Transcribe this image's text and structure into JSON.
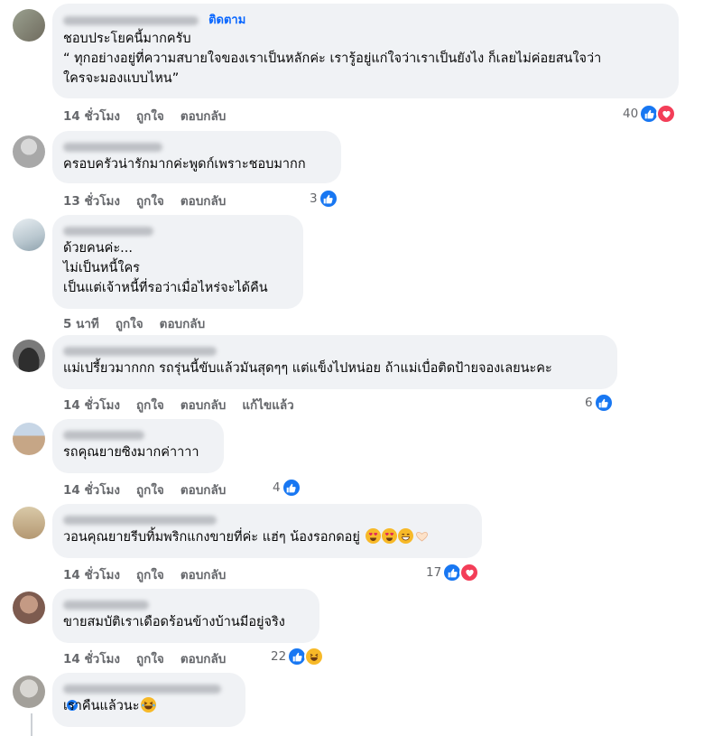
{
  "follow_label": "ติดตาม",
  "comments": [
    {
      "lines": [
        "ชอบประโยคนี้มากครับ",
        "“ ทุกอย่างอยู่ที่ความสบายใจของเราเป็นหลักค่ะ เรารู้อยู่แก่ใจว่าเราเป็นยังไง ก็เลยไม่ค่อยสนใจว่า",
        "ใครจะมองแบบไหน”"
      ],
      "time": "14 ชั่วโมง",
      "like": "ถูกใจ",
      "reply": "ตอบกลับ",
      "reaction_count": "40",
      "reactions": [
        "like-icon",
        "love-icon"
      ]
    },
    {
      "lines": [
        "ครอบครัวน่ารักมากค่ะพูดก์เพราะชอบมากก"
      ],
      "time": "13 ชั่วโมง",
      "like": "ถูกใจ",
      "reply": "ตอบกลับ",
      "reaction_count": "3",
      "reactions": [
        "like-icon"
      ]
    },
    {
      "lines": [
        "ด้วยคนค่ะ...",
        "ไม่เป็นหนี้ใคร",
        "เป็นแต่เจ้าหนี้ที่รอว่าเมื่อไหร่จะได้คืน"
      ],
      "time": "5 นาที",
      "like": "ถูกใจ",
      "reply": "ตอบกลับ"
    },
    {
      "lines": [
        "แม่เปรี้ยวมากกก รถรุ่นนี้ขับแล้วมันสุดๆๆ แต่แข็งไปหน่อย ถ้าแม่เบื่อติดป้ายจองเลยนะคะ"
      ],
      "time": "14 ชั่วโมง",
      "like": "ถูกใจ",
      "reply": "ตอบกลับ",
      "edited": "แก้ไขแล้ว",
      "reaction_count": "6",
      "reactions": [
        "like-icon"
      ]
    },
    {
      "lines": [
        "รถคุณยายซิงมากค่าาาา"
      ],
      "time": "14 ชั่วโมง",
      "like": "ถูกใจ",
      "reply": "ตอบกลับ",
      "reaction_count": "4",
      "reactions": [
        "like-icon"
      ]
    },
    {
      "lines": [
        "วอนคุณยายรีบทิ้มพริกแกงขายที่ค่ะ แฮ่ๆ น้องรอกดอยู่"
      ],
      "time": "14 ชั่วโมง",
      "like": "ถูกใจ",
      "reply": "ตอบกลับ",
      "reaction_count": "17",
      "reactions": [
        "like-icon",
        "love-icon"
      ],
      "inline_emojis": [
        "heart-eyes-emoji",
        "heart-eyes-emoji",
        "grin-emoji",
        "heart-hands-emoji"
      ]
    },
    {
      "lines": [
        "ขายสมบัติเราเดือดร้อนข้างบ้านมีอยู่จริง"
      ],
      "time": "14 ชั่วโมง",
      "like": "ถูกใจ",
      "reply": "ตอบกลับ",
      "reaction_count": "22",
      "reactions": [
        "like-icon",
        "haha-icon"
      ]
    },
    {
      "lines": [
        "เราคืนแล้วนะ"
      ],
      "inline_emojis": [
        "laughing-tears-emoji"
      ],
      "verified_icon": "verified-badge-icon"
    }
  ],
  "colors": {
    "bubble": "#f0f2f5",
    "meta_text": "#65676b",
    "link_blue": "#0866ff",
    "like": "#1877f2",
    "love": "#f33e58",
    "haha": "#f7b928"
  }
}
